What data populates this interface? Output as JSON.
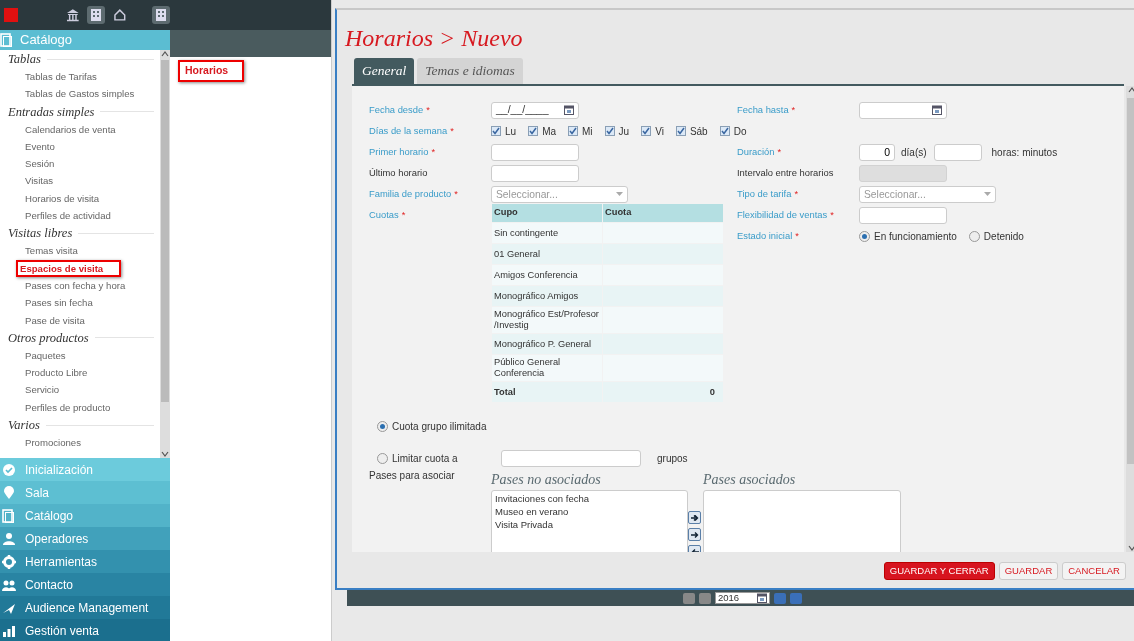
{
  "sidebar": {
    "header": "Catálogo",
    "sections": [
      {
        "title": "Tablas",
        "items": [
          {
            "label": "Tablas de Tarifas",
            "selected": false
          },
          {
            "label": "Tablas de Gastos simples",
            "selected": false
          }
        ]
      },
      {
        "title": "Entradas simples",
        "items": [
          {
            "label": "Calendarios de venta",
            "selected": false
          },
          {
            "label": "Evento",
            "selected": false
          },
          {
            "label": "Sesión",
            "selected": false
          },
          {
            "label": "Visitas",
            "selected": false
          },
          {
            "label": "Horarios de visita",
            "selected": false
          },
          {
            "label": "Perfiles de actividad",
            "selected": false
          }
        ]
      },
      {
        "title": "Visitas libres",
        "items": [
          {
            "label": "Temas visita",
            "selected": false
          },
          {
            "label": "Espacios de visita",
            "selected": true
          },
          {
            "label": "Pases con fecha y hora",
            "selected": false
          },
          {
            "label": "Pases sin fecha",
            "selected": false
          },
          {
            "label": "Pase de visita",
            "selected": false
          }
        ]
      },
      {
        "title": "Otros productos",
        "items": [
          {
            "label": "Paquetes",
            "selected": false
          },
          {
            "label": "Producto Libre",
            "selected": false
          },
          {
            "label": "Servicio",
            "selected": false
          },
          {
            "label": "Perfiles de producto",
            "selected": false
          }
        ]
      },
      {
        "title": "Varios",
        "items": [
          {
            "label": "Promociones",
            "selected": false
          }
        ]
      }
    ],
    "nav": [
      "Inicialización",
      "Sala",
      "Catálogo",
      "Operadores",
      "Herramientas",
      "Contacto",
      "Audience Management",
      "Gestión venta"
    ]
  },
  "subpanel": {
    "items": [
      {
        "label": "Horarios",
        "selected": true
      }
    ]
  },
  "dialog": {
    "title": "Horarios > Nuevo",
    "tabs": [
      {
        "label": "General",
        "selected": true
      },
      {
        "label": "Temas e idiomas",
        "selected": false
      }
    ],
    "left_fields": [
      {
        "kind": "date",
        "label": "Fecha desde",
        "required": true,
        "mark": "*",
        "value": "__/__/____"
      },
      {
        "kind": "days",
        "label": "Días de la semana",
        "required": true,
        "mark": "*",
        "days": [
          {
            "label": "Lu",
            "checked": true
          },
          {
            "label": "Ma",
            "checked": true
          },
          {
            "label": "Mi",
            "checked": true
          },
          {
            "label": "Ju",
            "checked": true
          },
          {
            "label": "Vi",
            "checked": true
          },
          {
            "label": "Sáb",
            "checked": true
          },
          {
            "label": "Do",
            "checked": true
          }
        ]
      },
      {
        "kind": "text",
        "label": "Primer horario",
        "required": true,
        "mark": "*",
        "disabled": false
      },
      {
        "kind": "text",
        "label": "Último horario",
        "required": false,
        "disabled": false
      },
      {
        "kind": "select",
        "label": "Familia de producto",
        "required": true,
        "mark": "*",
        "placeholder": "Seleccionar..."
      },
      {
        "kind": "table",
        "label": "Cuotas",
        "required": true,
        "mark": "*",
        "columns": [
          "Cupo",
          "Cuota"
        ],
        "rows": [
          {
            "cupo": "Sin contingente"
          },
          {
            "cupo": "01 General"
          },
          {
            "cupo": "Amigos Conferencia"
          },
          {
            "cupo": "Monográfico Amigos"
          },
          {
            "cupo": "Monográfico Est/Profesor /Investig"
          },
          {
            "cupo": "Monográfico P. General"
          },
          {
            "cupo": "Público General Conferencia"
          }
        ],
        "total": {
          "label": "Total",
          "value": "0"
        }
      }
    ],
    "right_fields": [
      {
        "kind": "date",
        "label": "Fecha hasta",
        "required": true,
        "mark": "*"
      },
      {
        "kind": "duration",
        "label": "Duración",
        "required": true,
        "mark": "*",
        "days_value": "0",
        "days_unit": "día(s)",
        "time_unit": "horas: minutos"
      },
      {
        "kind": "text",
        "label": "Intervalo entre horarios",
        "required": false,
        "disabled": true
      },
      {
        "kind": "select",
        "label": "Tipo de tarifa",
        "required": true,
        "mark": "*",
        "placeholder": "Seleccionar..."
      },
      {
        "kind": "text",
        "label": "Flexibilidad de ventas",
        "required": true,
        "mark": "*",
        "disabled": false
      },
      {
        "kind": "radios",
        "label": "Estado inicial",
        "required": true,
        "mark": "*",
        "options": [
          {
            "label": "En funcionamiento",
            "selected": true
          },
          {
            "label": "Detenido",
            "selected": false
          }
        ]
      }
    ],
    "group_quota": {
      "options": [
        {
          "label": "Cuota grupo ilimitada",
          "selected": true
        },
        {
          "label": "Limitar cuota a",
          "selected": false
        }
      ],
      "unit": "grupos"
    },
    "passes": {
      "label": "Pases para asociar",
      "available": {
        "title": "Pases no asociados",
        "items": [
          "Invitaciones con fecha",
          "Museo en verano",
          "Visita Privada"
        ]
      },
      "associated": {
        "title": "Pases asociados"
      }
    },
    "buttons": [
      {
        "label": "GUARDAR Y CERRAR",
        "kind": "primary"
      },
      {
        "label": "GUARDAR",
        "kind": "secondary"
      },
      {
        "label": "CANCELAR",
        "kind": "secondary"
      }
    ]
  },
  "pager": {
    "year": "2016"
  }
}
